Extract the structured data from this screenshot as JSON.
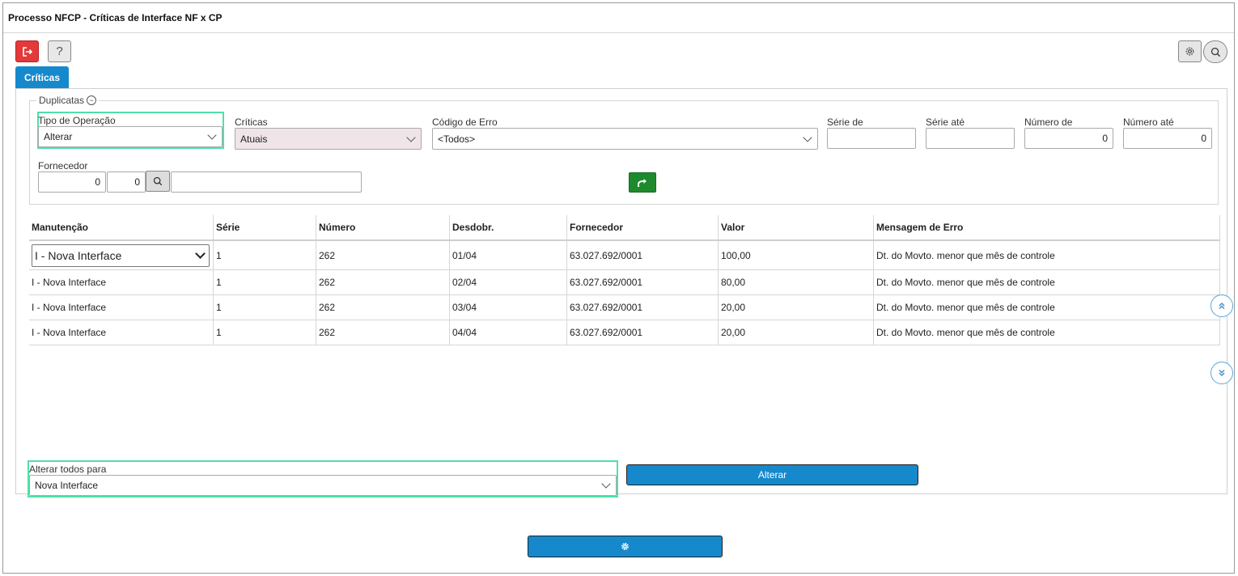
{
  "window": {
    "title": "Processo NFCP - Críticas de Interface NF x CP"
  },
  "toolbar": {
    "exit_icon": "exit-icon",
    "help_label": "?",
    "settings_icon": "gear-icon",
    "search_icon": "search-icon"
  },
  "tabs": [
    {
      "label": "Críticas"
    }
  ],
  "filters": {
    "legend": "Duplicatas",
    "tipo_operacao": {
      "label": "Tipo de Operação",
      "value": "Alterar"
    },
    "criticas": {
      "label": "Críticas",
      "value": "Atuais"
    },
    "codigo_erro": {
      "label": "Código de Erro",
      "value": "<Todos>"
    },
    "serie_de": {
      "label": "Série de",
      "value": ""
    },
    "serie_ate": {
      "label": "Série até",
      "value": ""
    },
    "numero_de": {
      "label": "Número de",
      "value": "0"
    },
    "numero_ate": {
      "label": "Número até",
      "value": "0"
    },
    "fornecedor": {
      "label": "Fornecedor",
      "code": "0",
      "sub": "0",
      "name": ""
    }
  },
  "table": {
    "columns": [
      "Manutenção",
      "Série",
      "Número",
      "Desdobr.",
      "Fornecedor",
      "Valor",
      "Mensagem de Erro"
    ],
    "rows": [
      [
        "I - Nova Interface",
        "1",
        "262",
        "01/04",
        "63.027.692/0001",
        "100,00",
        "Dt. do Movto. menor que mês de controle"
      ],
      [
        "I - Nova Interface",
        "1",
        "262",
        "02/04",
        "63.027.692/0001",
        "80,00",
        "Dt. do Movto. menor que mês de controle"
      ],
      [
        "I - Nova Interface",
        "1",
        "262",
        "03/04",
        "63.027.692/0001",
        "20,00",
        "Dt. do Movto. menor que mês de controle"
      ],
      [
        "I - Nova Interface",
        "1",
        "262",
        "04/04",
        "63.027.692/0001",
        "20,00",
        "Dt. do Movto. menor que mês de controle"
      ]
    ]
  },
  "bulk": {
    "label": "Alterar todos para",
    "value": "Nova Interface",
    "button_label": "Alterar"
  },
  "colors": {
    "primary": "#1589cc",
    "danger": "#e4393a",
    "success": "#1e8a2e",
    "highlight": "#4fe0a8"
  }
}
